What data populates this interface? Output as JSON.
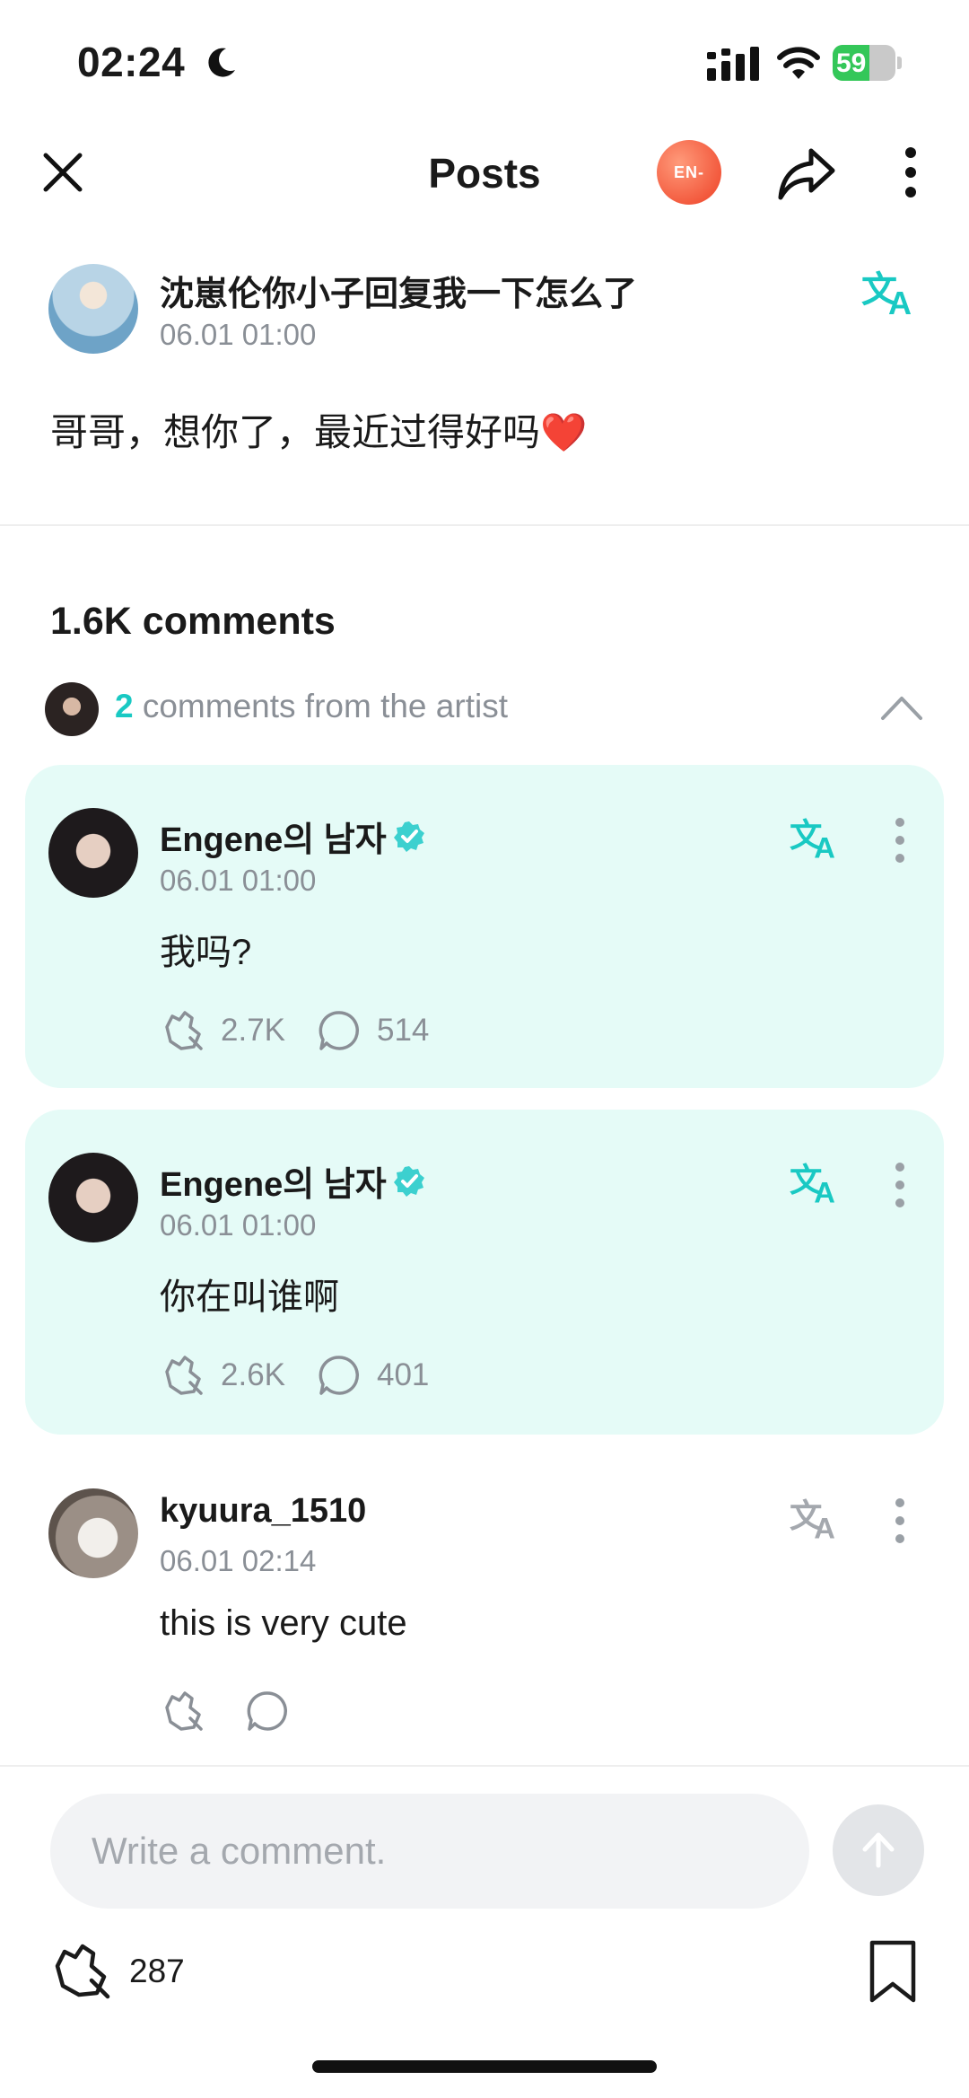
{
  "status_bar": {
    "time": "02:24",
    "battery": "59",
    "battery_level": 0.59
  },
  "header": {
    "title": "Posts",
    "artist_badge": "EN-"
  },
  "post": {
    "author": "沈崽伦你小子回复我一下怎么了",
    "timestamp": "06.01 01:00",
    "body": "哥哥，想你了，最近过得好吗❤️"
  },
  "comments_section": {
    "count_label": "1.6K comments",
    "artist_comments_count": "2",
    "artist_comments_label": "comments from the artist"
  },
  "comments": [
    {
      "author": "Engene의 남자",
      "verified": true,
      "timestamp": "06.01 01:00",
      "body": "我吗?",
      "likes": "2.7K",
      "replies": "514"
    },
    {
      "author": "Engene의 남자",
      "verified": true,
      "timestamp": "06.01 01:00",
      "body": "你在叫谁啊",
      "likes": "2.6K",
      "replies": "401"
    },
    {
      "author": "kyuura_1510",
      "verified": false,
      "timestamp": "06.01 02:14",
      "body": "this is very cute",
      "likes": "",
      "replies": ""
    }
  ],
  "bottom_bar": {
    "comment_placeholder": "Write a comment.",
    "like_count": "287"
  },
  "colors": {
    "accent": "#19c9c3",
    "artist_card_bg": "#e5fbf7",
    "badge": "#f2563a"
  },
  "icons": [
    "close-icon",
    "share-icon",
    "more-vertical-icon",
    "translate-icon",
    "verified-icon",
    "cheer-icon",
    "comment-bubble-icon",
    "send-arrow-icon",
    "bookmark-icon",
    "moon-icon",
    "signal-icon",
    "wifi-icon",
    "battery-icon",
    "chevron-up-icon"
  ]
}
